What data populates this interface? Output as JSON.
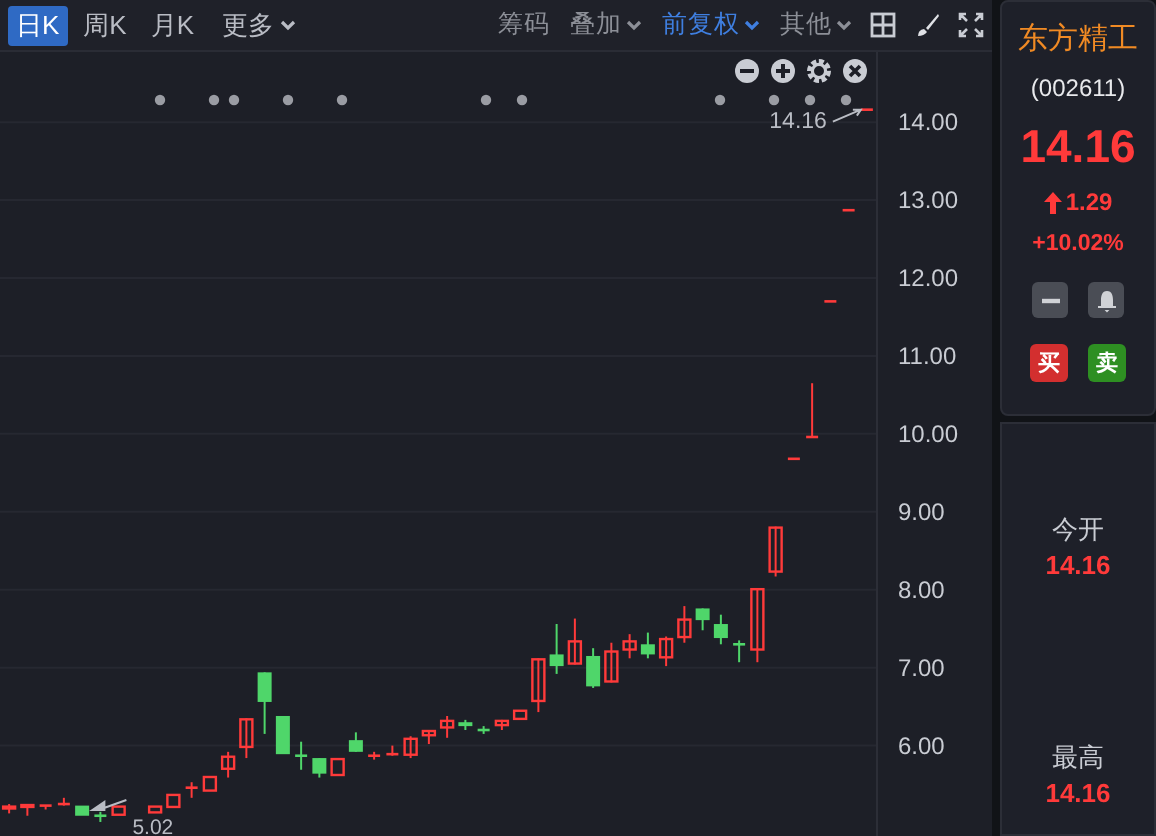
{
  "toolbar": {
    "periods": [
      {
        "label": "日K",
        "selected": true
      },
      {
        "label": "周K",
        "selected": false
      },
      {
        "label": "月K",
        "selected": false
      }
    ],
    "more": {
      "label": "更多"
    },
    "tools": [
      {
        "label": "筹码",
        "kind": "plain",
        "selected": false
      },
      {
        "label": "叠加",
        "kind": "dropdown",
        "selected": false
      },
      {
        "label": "前复权",
        "kind": "dropdown",
        "selected": true
      },
      {
        "label": "其他",
        "kind": "dropdown",
        "selected": false
      }
    ]
  },
  "chart": {
    "chart_data": {
      "type": "candlestick",
      "categories": [
        null,
        null,
        null,
        null,
        null,
        null,
        null,
        null,
        null,
        null,
        null,
        null,
        null,
        null,
        null,
        null,
        null,
        null,
        null,
        null,
        null,
        null,
        null,
        null,
        null,
        null,
        null,
        null,
        null,
        null,
        null,
        null,
        null,
        null,
        null,
        null,
        null,
        null,
        null,
        null,
        null,
        null,
        null,
        null,
        null,
        null,
        null,
        null
      ],
      "ohlc": [
        [
          5.18,
          5.25,
          5.13,
          5.23
        ],
        [
          5.2,
          5.25,
          5.1,
          5.25
        ],
        [
          5.2,
          5.23,
          5.18,
          5.23
        ],
        [
          5.23,
          5.33,
          5.23,
          5.25
        ],
        [
          5.23,
          5.23,
          5.1,
          5.1
        ],
        [
          5.1,
          5.15,
          5.02,
          5.09
        ],
        [
          5.1,
          5.23,
          5.1,
          5.23
        ],
        null,
        [
          5.13,
          5.23,
          5.13,
          5.23
        ],
        [
          5.2,
          5.38,
          5.2,
          5.38
        ],
        [
          5.43,
          5.53,
          5.33,
          5.46
        ],
        [
          5.41,
          5.61,
          5.41,
          5.61
        ],
        [
          5.69,
          5.92,
          5.59,
          5.87
        ],
        [
          5.97,
          6.35,
          5.84,
          6.35
        ],
        [
          6.94,
          6.94,
          6.15,
          6.56
        ],
        [
          6.38,
          6.38,
          5.89,
          5.89
        ],
        [
          5.87,
          6.05,
          5.69,
          5.86
        ],
        [
          5.84,
          5.84,
          5.59,
          5.64
        ],
        [
          5.61,
          5.84,
          5.61,
          5.84
        ],
        [
          6.07,
          6.17,
          5.92,
          5.92
        ],
        [
          5.87,
          5.92,
          5.82,
          5.87
        ],
        [
          5.87,
          6.0,
          5.87,
          5.89
        ],
        [
          5.87,
          6.12,
          5.84,
          6.1
        ],
        [
          6.12,
          6.2,
          6.02,
          6.2
        ],
        [
          6.22,
          6.38,
          6.1,
          6.33
        ],
        [
          6.3,
          6.33,
          6.2,
          6.25
        ],
        [
          6.2,
          6.25,
          6.15,
          6.19
        ],
        [
          6.25,
          6.33,
          6.2,
          6.33
        ],
        [
          6.33,
          6.46,
          6.33,
          6.46
        ],
        [
          6.56,
          7.12,
          6.43,
          7.12
        ],
        [
          7.17,
          7.56,
          6.92,
          7.02
        ],
        [
          7.04,
          7.63,
          7.04,
          7.35
        ],
        [
          7.15,
          7.25,
          6.74,
          6.76
        ],
        [
          6.81,
          7.32,
          6.81,
          7.22
        ],
        [
          7.22,
          7.43,
          7.12,
          7.35
        ],
        [
          7.3,
          7.45,
          7.12,
          7.17
        ],
        [
          7.12,
          7.4,
          7.02,
          7.38
        ],
        [
          7.38,
          7.79,
          7.32,
          7.63
        ],
        [
          7.76,
          7.76,
          7.48,
          7.61
        ],
        [
          7.56,
          7.68,
          7.3,
          7.38
        ],
        [
          7.3,
          7.35,
          7.07,
          7.29
        ],
        [
          7.22,
          8.02,
          7.07,
          8.02
        ],
        [
          8.22,
          8.81,
          8.17,
          8.81
        ],
        [
          9.68,
          9.68,
          9.68,
          9.68
        ],
        [
          9.96,
          10.65,
          9.96,
          9.96
        ],
        [
          11.7,
          11.7,
          11.7,
          11.7
        ],
        [
          12.87,
          12.87,
          12.87,
          12.87
        ],
        [
          14.16,
          14.16,
          14.16,
          14.16
        ]
      ],
      "ylim": [
        4.84,
        14.9
      ],
      "grid": true,
      "yticks": [
        {
          "value": 14,
          "label": "14.00"
        },
        {
          "value": 13,
          "label": "13.00"
        },
        {
          "value": 12,
          "label": "12.00"
        },
        {
          "value": 11,
          "label": "11.00"
        },
        {
          "value": 10,
          "label": "10.00"
        },
        {
          "value": 9,
          "label": "9.00"
        },
        {
          "value": 8,
          "label": "8.00"
        },
        {
          "value": 7,
          "label": "7.00"
        },
        {
          "value": 6,
          "label": "6.00"
        }
      ]
    },
    "high_label": "14.16",
    "low_label": "5.02"
  },
  "quote": {
    "name": "东方精工",
    "code": "(002611)",
    "price": "14.16",
    "change": "1.29",
    "change_pct": "+10.02%",
    "buy": "买",
    "sell": "卖"
  },
  "stats": [
    {
      "label": "今开",
      "value": "14.16"
    },
    {
      "label": "最高",
      "value": "14.16"
    }
  ]
}
